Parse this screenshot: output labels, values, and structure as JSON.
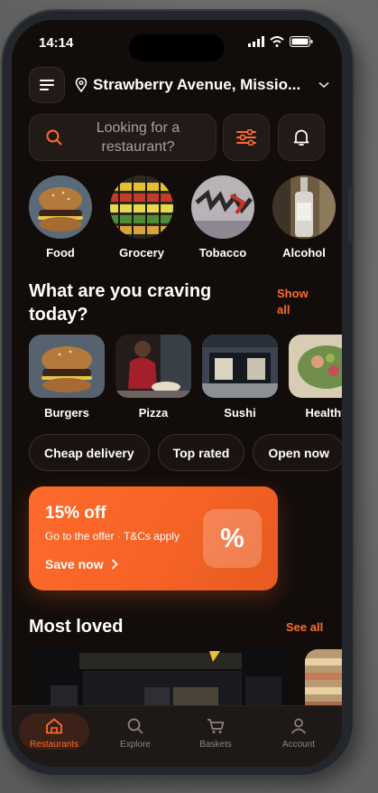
{
  "status": {
    "time": "14:14"
  },
  "header": {
    "location": "Strawberry Avenue, Missio..."
  },
  "search": {
    "placeholder": "Looking for a restaurant?"
  },
  "categories": [
    {
      "label": "Food"
    },
    {
      "label": "Grocery"
    },
    {
      "label": "Tobacco"
    },
    {
      "label": "Alcohol"
    }
  ],
  "craving": {
    "title": "What are you craving today?",
    "show_all": "Show all",
    "items": [
      {
        "label": "Burgers"
      },
      {
        "label": "Pizza"
      },
      {
        "label": "Sushi"
      },
      {
        "label": "Healthy"
      }
    ]
  },
  "filters": [
    "Cheap delivery",
    "Top rated",
    "Open now"
  ],
  "promo": {
    "title": "15% off",
    "subtitle": "Go to the offer · T&Cs apply",
    "cta": "Save now",
    "badge": "%"
  },
  "most_loved": {
    "title": "Most loved",
    "see_all": "See all"
  },
  "tabs": [
    {
      "label": "Restaurants",
      "icon": "home-icon",
      "active": true
    },
    {
      "label": "Explore",
      "icon": "search-icon",
      "active": false
    },
    {
      "label": "Baskets",
      "icon": "basket-icon",
      "active": false
    },
    {
      "label": "Account",
      "icon": "account-icon",
      "active": false
    }
  ],
  "colors": {
    "accent": "#ff6b2c",
    "background": "#120d0b",
    "promo": "#f46225"
  }
}
